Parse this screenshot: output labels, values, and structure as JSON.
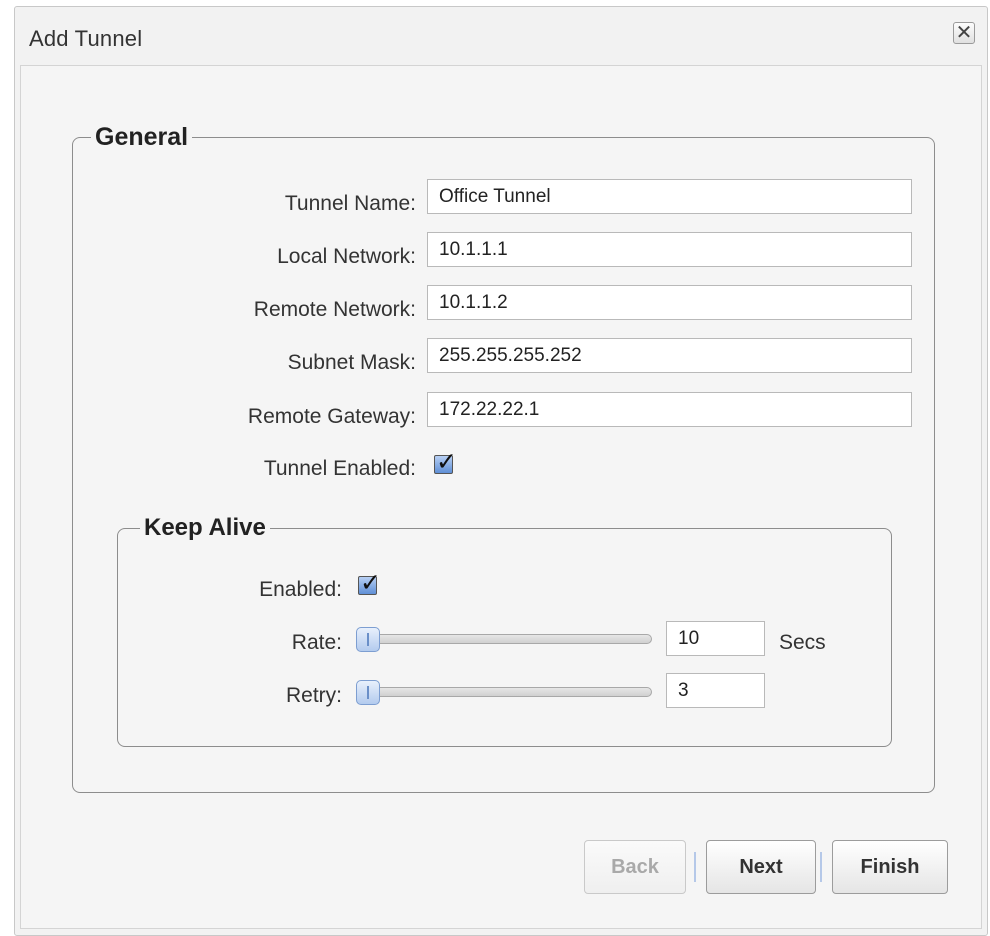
{
  "dialog": {
    "title": "Add Tunnel",
    "close_glyph": "✕"
  },
  "general": {
    "legend": "General",
    "fields": {
      "tunnel_name": {
        "label": "Tunnel Name:",
        "value": "Office Tunnel"
      },
      "local_network": {
        "label": "Local Network:",
        "value": "10.1.1.1"
      },
      "remote_network": {
        "label": "Remote Network:",
        "value": "10.1.1.2"
      },
      "subnet_mask": {
        "label": "Subnet Mask:",
        "value": "255.255.255.252"
      },
      "remote_gateway": {
        "label": "Remote Gateway:",
        "value": "172.22.22.1"
      }
    },
    "tunnel_enabled": {
      "label": "Tunnel Enabled:",
      "checked": true
    }
  },
  "keep_alive": {
    "legend": "Keep Alive",
    "enabled": {
      "label": "Enabled:",
      "checked": true
    },
    "rate": {
      "label": "Rate:",
      "value": "10",
      "unit": "Secs",
      "slider_fraction": 0.0
    },
    "retry": {
      "label": "Retry:",
      "value": "3",
      "slider_fraction": 0.0
    }
  },
  "buttons": {
    "back": "Back",
    "next": "Next",
    "finish": "Finish"
  },
  "icons": {
    "check_glyph": "✓"
  },
  "colors": {
    "checkbox_blue": "#5f8fd6",
    "separator_blue": "#b5c8e8"
  }
}
